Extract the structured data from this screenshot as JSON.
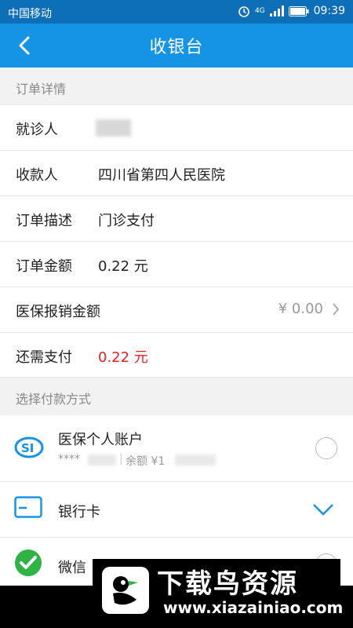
{
  "status_bar": {
    "carrier": "中国移动",
    "network": "4G",
    "time": "09:39"
  },
  "header": {
    "title": "收银台"
  },
  "order_section": {
    "title": "订单详情"
  },
  "order_rows": [
    {
      "label": "就诊人",
      "value": ""
    },
    {
      "label": "收款人",
      "value": "四川省第四人民医院"
    },
    {
      "label": "订单描述",
      "value": "门诊支付"
    },
    {
      "label": "订单金额",
      "value": "0.22 元"
    },
    {
      "label": "医保报销金额",
      "value": "¥ 0.00"
    },
    {
      "label": "还需支付",
      "value": "0.22 元"
    }
  ],
  "payment_section": {
    "title": "选择付款方式"
  },
  "payment_methods": [
    {
      "name": "医保个人账户",
      "account_masked": "****",
      "balance_label": "余额 ¥1"
    },
    {
      "name": "银行卡"
    },
    {
      "name": "微信"
    }
  ],
  "watermark": {
    "text": "下载鸟资源",
    "url": "www.xiazainiao.com"
  },
  "colors": {
    "nav": "#1593e5",
    "status": "#0d6fb8",
    "due": "#e22020",
    "check": "#2fb344"
  }
}
